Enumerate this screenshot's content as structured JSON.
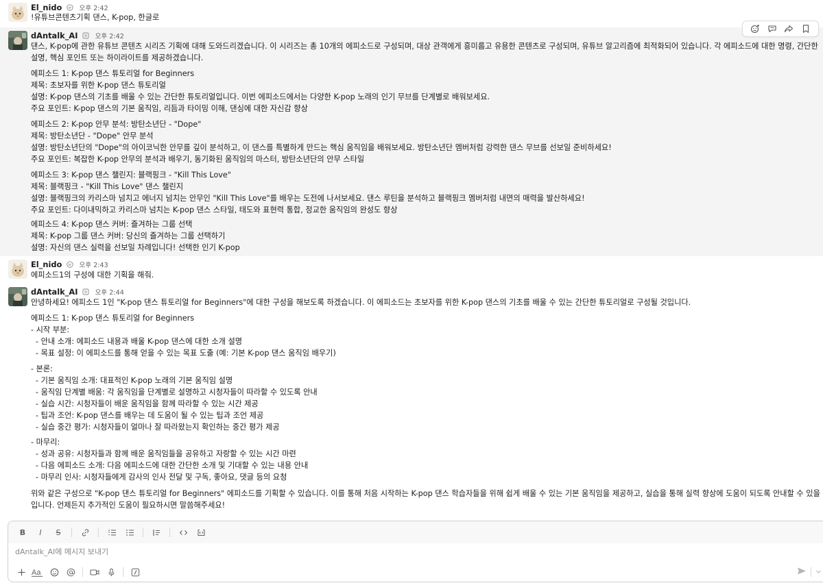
{
  "messages": [
    {
      "user": "El_nido",
      "time": "오후 2:42",
      "lines": [
        "!유튜브콘텐츠기획 댄스, K-pop, 한글로"
      ]
    },
    {
      "user": "dAntalk_AI",
      "time": "오후 2:42",
      "lines": [
        "댄스, K-pop에 관한 유튜브 콘텐츠 시리즈 기획에 대해 도와드리겠습니다. 이 시리즈는 총 10개의 에피소드로 구성되며, 대상 관객에게 흥미롭고 유용한 콘텐츠로 구성되며, 유튜브 알고리즘에 최적화되어 있습니다. 각 에피소드에 대한 명령, 간단한",
        "설명, 핵심 포인트 또는 하이라이트를 제공하겠습니다.",
        "에피소드 1: K-pop 댄스 튜토리얼 for Beginners",
        "제목: 초보자를 위한 K-pop 댄스 튜토리얼",
        "설명: K-pop 댄스의 기초를 배울 수 있는 간단한 튜토리얼입니다. 이번 에피소드에서는 다양한 K-pop 노래의 인기 무브를 단계별로 배워보세요.",
        "주요 포인트: K-pop 댄스의 기본 움직임, 리듬과 타이밍 이해, 댄싱에 대한 자신감 향상",
        "에피소드 2: K-pop 안무 분석: 방탄소년단 - \"Dope\"",
        "제목: 방탄소년단 - \"Dope\" 안무 분석",
        "설명: 방탄소년단의 \"Dope\"의 아이코닉한 안무를 깊이 분석하고, 이 댄스를 특별하게 만드는 핵심 움직임을 배워보세요. 방탄소년단 멤버처럼 강력한 댄스 무브를 선보일 준비하세요!",
        "주요 포인트: 복잡한 K-pop 안무의 분석과 배우기, 동기화된 움직임의 마스터, 방탄소년단의 안무 스타일",
        "에피소드 3: K-pop 댄스 챌린지: 블랙핑크 - \"Kill This Love\"",
        "제목: 블랙핑크 - \"Kill This Love\" 댄스 챌린지",
        "설명: 블랙핑크의 카리스마 넘치고 에너지 넘치는 안무인 \"Kill This Love\"를 배우는 도전에 나서보세요. 댄스 루틴을 분석하고 블랙핑크 멤버처럼 내면의 매력을 발산하세요!",
        "주요 포인트: 다이내믹하고 카리스마 넘치는 K-pop 댄스 스타일, 태도와 표현력 통합, 정교한 움직임의 완성도 향상",
        "에피소드 4: K-pop 댄스 커버: 즐겨하는 그룹 선택",
        "제목: K-pop 그룹 댄스 커버: 당신의 즐겨하는 그룹 선택하기",
        "설명: 자신의 댄스 실력을 선보일 차례입니다! 선택한 인기 K-pop"
      ]
    },
    {
      "user": "El_nido",
      "time": "오후 2:43",
      "lines": [
        "에피소드1의 구성에 대한 기획을 해줘."
      ]
    },
    {
      "user": "dAntalk_AI",
      "time": "오후 2:44",
      "lines": [
        "안녕하세요! 에피소드 1인 \"K-pop 댄스 튜토리얼 for Beginners\"에 대한 구성을 해보도록 하겠습니다. 이 에피소드는 초보자를 위한 K-pop 댄스의 기초를 배울 수 있는 간단한 튜토리얼로 구성될 것입니다.",
        "에피소드 1: K-pop 댄스 튜토리얼 for Beginners",
        "- 시작 부분:",
        "- 안내 소개: 에피소드 내용과 배울 K-pop 댄스에 대한 소개 설명",
        "- 목표 설정: 이 에피소드를 통해 얻을 수 있는 목표 도출 (예: 기본 K-pop 댄스 움직임 배우기)",
        "- 본론:",
        "- 기본 움직임 소개: 대표적인 K-pop 노래의 기본 움직임 설명",
        "- 움직임 단계별 배움: 각 움직임을 단계별로 설명하고 시청자들이 따라할 수 있도록 안내",
        "- 실습 시간: 시청자들이 배운 움직임을 함께 따라할 수 있는 시간 제공",
        "- 팁과 조언: K-pop 댄스를 배우는 데 도움이 될 수 있는 팁과 조언 제공",
        "- 실습 중간 평가: 시청자들이 얼마나 잘 따라왔는지 확인하는 중간 평가 제공",
        "- 마무리:",
        "- 성과 공유: 시청자들과 함께 배운 움직임들을 공유하고 자랑할 수 있는 시간 마련",
        "- 다음 에피소드 소개: 다음 에피소드에 대한 간단한 소개 및 기대할 수 있는 내용 안내",
        "- 마무리 인사: 시청자들에게 감사의 인사 전달 및 구독, 좋아요, 댓글 등의 요청",
        "위와 같은 구성으로 \"K-pop 댄스 튜토리얼 for Beginners\" 에피소드를 기획할 수 있습니다. 이를 통해 처음 시작하는 K-pop 댄스 학습자들을 위해 쉽게 배울 수 있는 기본 움직임을 제공하고, 실습을 통해 실력 향상에 도움이 되도록 안내할 수 있을 것",
        "입니다. 언제든지 추가적인 도움이 필요하시면 말씀해주세요!"
      ]
    }
  ],
  "message_actions": [
    "add-reaction-icon",
    "reply-in-thread-icon",
    "share-icon",
    "bookmark-icon"
  ],
  "composer": {
    "placeholder": "dAntalk_AI에 메시지 보내기",
    "value": "",
    "format_buttons": [
      "B",
      "I",
      "S"
    ]
  },
  "colors": {
    "highlight_bg": "#f4f4f4",
    "text": "#1d1c1d",
    "muted": "#616061"
  }
}
